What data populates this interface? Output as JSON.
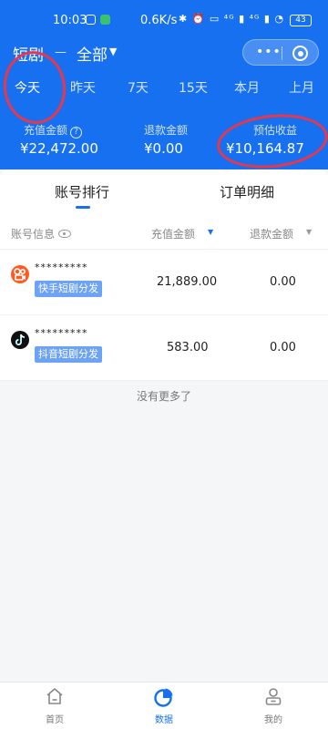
{
  "status_bar": {
    "time": "10:03",
    "speed": "0.6K/s",
    "icons": "✱ ⏰ ▭ ⁴ᴳ ▮ ⁴ᴳ ▮ ◔",
    "battery": "43"
  },
  "header": {
    "channel": "短剧",
    "separator": "—",
    "filter": "全部",
    "filter_caret": "▼",
    "menu_dots": "•••"
  },
  "date_tabs": [
    "今天",
    "昨天",
    "7天",
    "15天",
    "本月",
    "上月"
  ],
  "stats": {
    "recharge_label": "充值金额",
    "recharge_help": "?",
    "recharge_value": "¥22,472.00",
    "refund_label": "退款金额",
    "refund_value": "¥0.00",
    "income_label": "预估收益",
    "income_value": "¥10,164.87"
  },
  "segments": {
    "rank": "账号排行",
    "orders": "订单明细"
  },
  "table_header": {
    "account_info": "账号信息",
    "recharge": "充值金额",
    "refund": "退款金额",
    "sort_caret": "▼"
  },
  "rows": [
    {
      "name": "*********",
      "platform": "快手短剧分发",
      "recharge": "21,889.00",
      "refund": "0.00",
      "icon": "kuaishou-logo-icon"
    },
    {
      "name": "*********",
      "platform": "抖音短剧分发",
      "recharge": "583.00",
      "refund": "0.00",
      "icon": "douyin-logo-icon"
    }
  ],
  "no_more": "没有更多了",
  "bottom_nav": {
    "home": "首页",
    "data": "数据",
    "mine": "我的"
  },
  "colors": {
    "primary": "#1670f0",
    "annotation": "#e8374b",
    "kuaishou": "#ff5a1f",
    "douyin": "#111111",
    "badge": "#6da3f5"
  }
}
